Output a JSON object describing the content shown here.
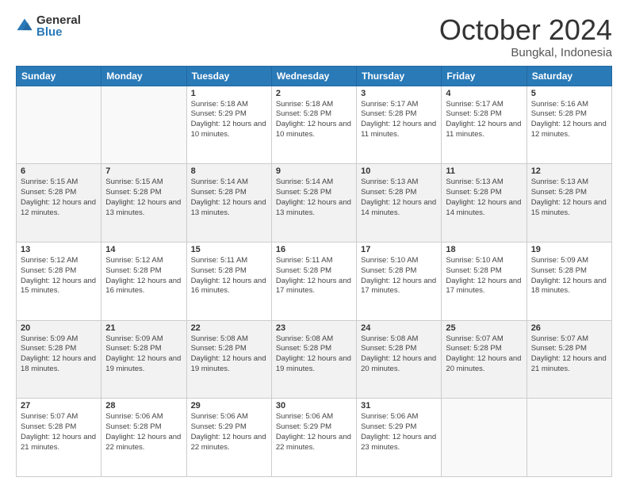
{
  "header": {
    "logo_general": "General",
    "logo_blue": "Blue",
    "month_title": "October 2024",
    "location": "Bungkal, Indonesia"
  },
  "days_of_week": [
    "Sunday",
    "Monday",
    "Tuesday",
    "Wednesday",
    "Thursday",
    "Friday",
    "Saturday"
  ],
  "weeks": [
    [
      {
        "day": "",
        "info": ""
      },
      {
        "day": "",
        "info": ""
      },
      {
        "day": "1",
        "info": "Sunrise: 5:18 AM\nSunset: 5:29 PM\nDaylight: 12 hours and 10 minutes."
      },
      {
        "day": "2",
        "info": "Sunrise: 5:18 AM\nSunset: 5:28 PM\nDaylight: 12 hours and 10 minutes."
      },
      {
        "day": "3",
        "info": "Sunrise: 5:17 AM\nSunset: 5:28 PM\nDaylight: 12 hours and 11 minutes."
      },
      {
        "day": "4",
        "info": "Sunrise: 5:17 AM\nSunset: 5:28 PM\nDaylight: 12 hours and 11 minutes."
      },
      {
        "day": "5",
        "info": "Sunrise: 5:16 AM\nSunset: 5:28 PM\nDaylight: 12 hours and 12 minutes."
      }
    ],
    [
      {
        "day": "6",
        "info": "Sunrise: 5:15 AM\nSunset: 5:28 PM\nDaylight: 12 hours and 12 minutes."
      },
      {
        "day": "7",
        "info": "Sunrise: 5:15 AM\nSunset: 5:28 PM\nDaylight: 12 hours and 13 minutes."
      },
      {
        "day": "8",
        "info": "Sunrise: 5:14 AM\nSunset: 5:28 PM\nDaylight: 12 hours and 13 minutes."
      },
      {
        "day": "9",
        "info": "Sunrise: 5:14 AM\nSunset: 5:28 PM\nDaylight: 12 hours and 13 minutes."
      },
      {
        "day": "10",
        "info": "Sunrise: 5:13 AM\nSunset: 5:28 PM\nDaylight: 12 hours and 14 minutes."
      },
      {
        "day": "11",
        "info": "Sunrise: 5:13 AM\nSunset: 5:28 PM\nDaylight: 12 hours and 14 minutes."
      },
      {
        "day": "12",
        "info": "Sunrise: 5:13 AM\nSunset: 5:28 PM\nDaylight: 12 hours and 15 minutes."
      }
    ],
    [
      {
        "day": "13",
        "info": "Sunrise: 5:12 AM\nSunset: 5:28 PM\nDaylight: 12 hours and 15 minutes."
      },
      {
        "day": "14",
        "info": "Sunrise: 5:12 AM\nSunset: 5:28 PM\nDaylight: 12 hours and 16 minutes."
      },
      {
        "day": "15",
        "info": "Sunrise: 5:11 AM\nSunset: 5:28 PM\nDaylight: 12 hours and 16 minutes."
      },
      {
        "day": "16",
        "info": "Sunrise: 5:11 AM\nSunset: 5:28 PM\nDaylight: 12 hours and 17 minutes."
      },
      {
        "day": "17",
        "info": "Sunrise: 5:10 AM\nSunset: 5:28 PM\nDaylight: 12 hours and 17 minutes."
      },
      {
        "day": "18",
        "info": "Sunrise: 5:10 AM\nSunset: 5:28 PM\nDaylight: 12 hours and 17 minutes."
      },
      {
        "day": "19",
        "info": "Sunrise: 5:09 AM\nSunset: 5:28 PM\nDaylight: 12 hours and 18 minutes."
      }
    ],
    [
      {
        "day": "20",
        "info": "Sunrise: 5:09 AM\nSunset: 5:28 PM\nDaylight: 12 hours and 18 minutes."
      },
      {
        "day": "21",
        "info": "Sunrise: 5:09 AM\nSunset: 5:28 PM\nDaylight: 12 hours and 19 minutes."
      },
      {
        "day": "22",
        "info": "Sunrise: 5:08 AM\nSunset: 5:28 PM\nDaylight: 12 hours and 19 minutes."
      },
      {
        "day": "23",
        "info": "Sunrise: 5:08 AM\nSunset: 5:28 PM\nDaylight: 12 hours and 19 minutes."
      },
      {
        "day": "24",
        "info": "Sunrise: 5:08 AM\nSunset: 5:28 PM\nDaylight: 12 hours and 20 minutes."
      },
      {
        "day": "25",
        "info": "Sunrise: 5:07 AM\nSunset: 5:28 PM\nDaylight: 12 hours and 20 minutes."
      },
      {
        "day": "26",
        "info": "Sunrise: 5:07 AM\nSunset: 5:28 PM\nDaylight: 12 hours and 21 minutes."
      }
    ],
    [
      {
        "day": "27",
        "info": "Sunrise: 5:07 AM\nSunset: 5:28 PM\nDaylight: 12 hours and 21 minutes."
      },
      {
        "day": "28",
        "info": "Sunrise: 5:06 AM\nSunset: 5:28 PM\nDaylight: 12 hours and 22 minutes."
      },
      {
        "day": "29",
        "info": "Sunrise: 5:06 AM\nSunset: 5:29 PM\nDaylight: 12 hours and 22 minutes."
      },
      {
        "day": "30",
        "info": "Sunrise: 5:06 AM\nSunset: 5:29 PM\nDaylight: 12 hours and 22 minutes."
      },
      {
        "day": "31",
        "info": "Sunrise: 5:06 AM\nSunset: 5:29 PM\nDaylight: 12 hours and 23 minutes."
      },
      {
        "day": "",
        "info": ""
      },
      {
        "day": "",
        "info": ""
      }
    ]
  ]
}
